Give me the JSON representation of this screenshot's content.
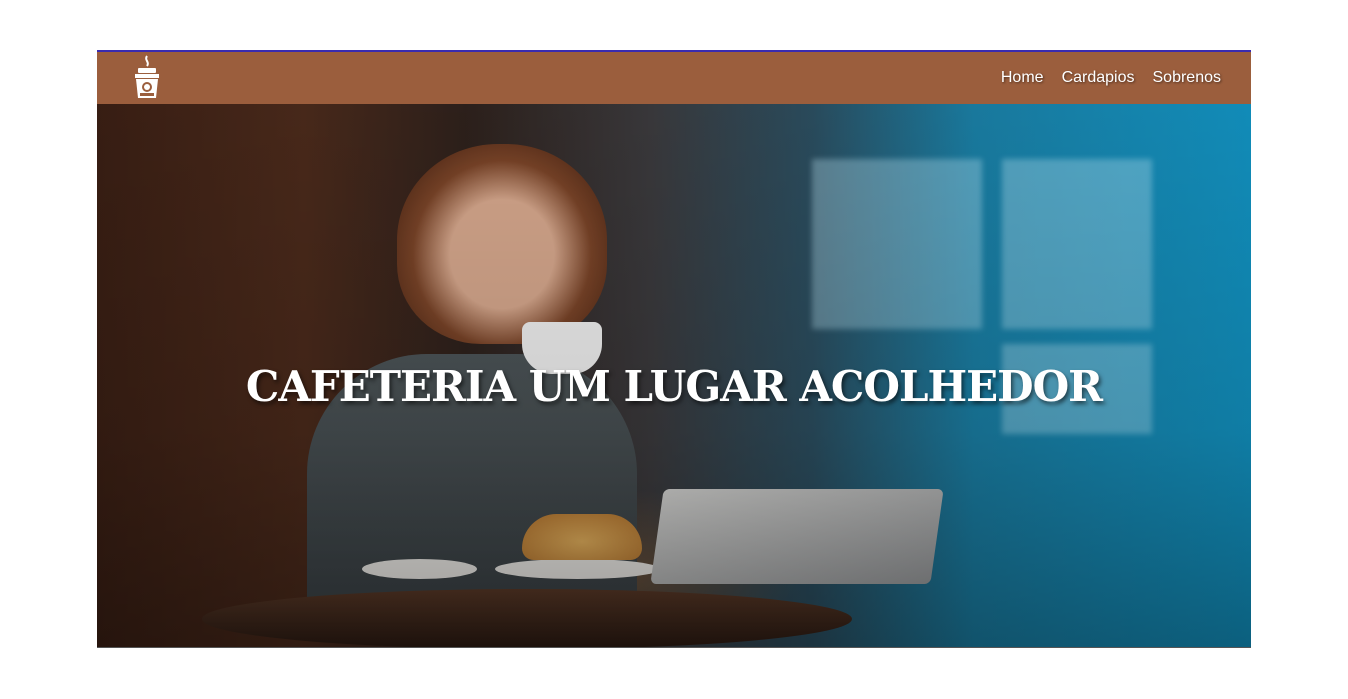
{
  "navbar": {
    "logo_icon": "coffee-cup-icon",
    "background_color": "#9b5e3d",
    "links": [
      {
        "label": "Home"
      },
      {
        "label": "Cardapios"
      },
      {
        "label": "Sobrenos"
      }
    ]
  },
  "hero": {
    "title": "CAFETERIA UM LUGAR ACOLHEDOR",
    "image_description_icon": "cafe-woman-drinking-coffee-photo"
  }
}
